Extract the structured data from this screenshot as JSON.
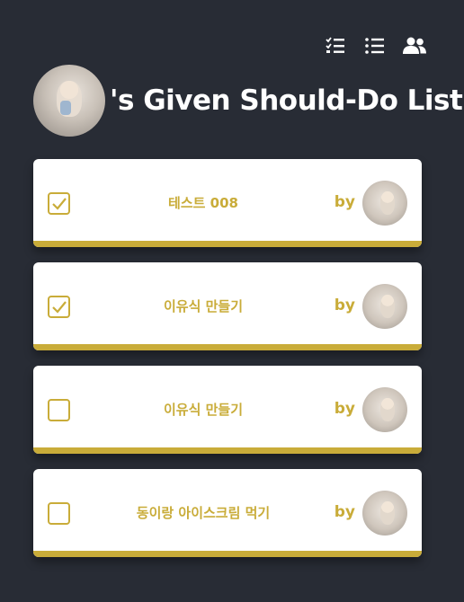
{
  "nav": {
    "icons": [
      "checklist-icon",
      "list-icon",
      "users-icon"
    ]
  },
  "header": {
    "title": "'s Given Should-Do List"
  },
  "tasks": [
    {
      "text": "테스트 008",
      "checked": true,
      "by_label": "by"
    },
    {
      "text": "이유식 만들기",
      "checked": true,
      "by_label": "by"
    },
    {
      "text": "이유식 만들기",
      "checked": false,
      "by_label": "by"
    },
    {
      "text": "동이랑 아이스크림 먹기",
      "checked": false,
      "by_label": "by"
    }
  ],
  "colors": {
    "background": "#282c35",
    "accent": "#c9ac39",
    "card": "#ffffff"
  }
}
